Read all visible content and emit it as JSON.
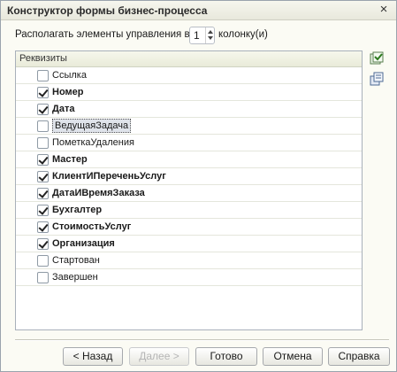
{
  "window": {
    "title": "Конструктор формы бизнес-процесса",
    "close_glyph": "×"
  },
  "columns_control": {
    "label_before": "Располагать элементы управления в",
    "value": "1",
    "label_after": "колонку(и)"
  },
  "grid": {
    "header": "Реквизиты",
    "rows": [
      {
        "label": "Ссылка",
        "checked": false,
        "bold": false
      },
      {
        "label": "Номер",
        "checked": true,
        "bold": true
      },
      {
        "label": "Дата",
        "checked": true,
        "bold": true
      },
      {
        "label": "ВедущаяЗадача",
        "checked": false,
        "bold": false,
        "selected": true
      },
      {
        "label": "ПометкаУдаления",
        "checked": false,
        "bold": false
      },
      {
        "label": "Мастер",
        "checked": true,
        "bold": true
      },
      {
        "label": "КлиентИПереченьУслуг",
        "checked": true,
        "bold": true
      },
      {
        "label": "ДатаИВремяЗаказа",
        "checked": true,
        "bold": true
      },
      {
        "label": "Бухгалтер",
        "checked": true,
        "bold": true
      },
      {
        "label": "СтоимостьУслуг",
        "checked": true,
        "bold": true
      },
      {
        "label": "Организация",
        "checked": true,
        "bold": true
      },
      {
        "label": "Стартован",
        "checked": false,
        "bold": false
      },
      {
        "label": "Завершен",
        "checked": false,
        "bold": false
      }
    ]
  },
  "side_tools": {
    "check_all_icon": "check-all-icon",
    "copy_icon": "copy-icon"
  },
  "buttons": {
    "back": "< Назад",
    "next": "Далее >",
    "done": "Готово",
    "cancel": "Отмена",
    "help": "Справка"
  }
}
